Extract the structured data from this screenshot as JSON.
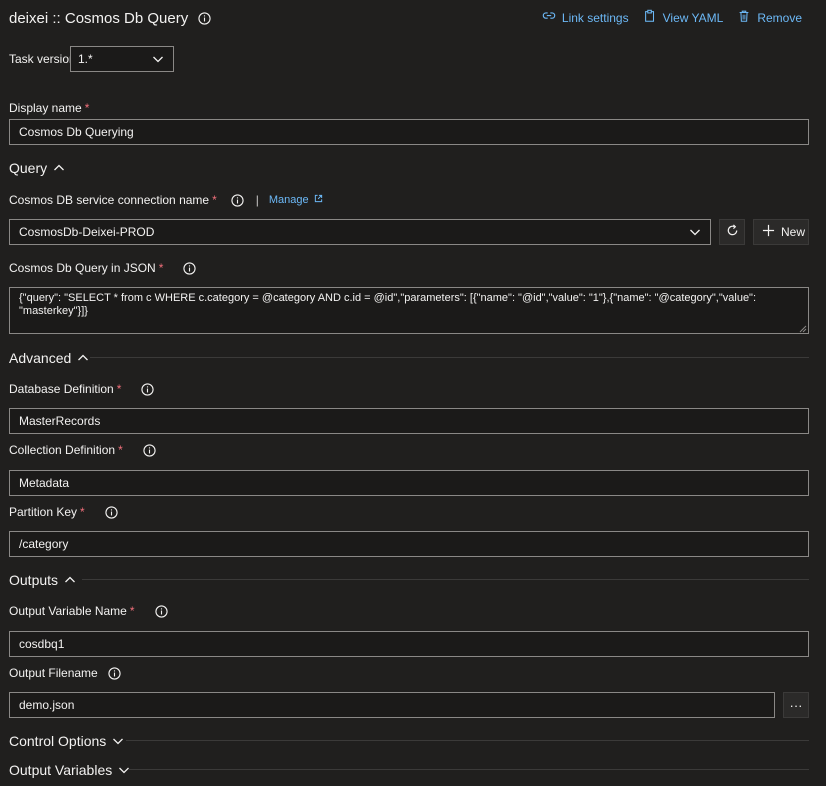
{
  "header": {
    "title": "deixei :: Cosmos Db Query",
    "link_settings": "Link settings",
    "view_yaml": "View YAML",
    "remove": "Remove"
  },
  "task_version": {
    "label": "Task version",
    "value": "1.*"
  },
  "display_name": {
    "label": "Display name",
    "value": "Cosmos Db Querying"
  },
  "query_section": {
    "title": "Query",
    "connection_label": "Cosmos DB service connection name",
    "manage": "Manage",
    "connection_value": "CosmosDb-Deixei-PROD",
    "new_label": "New",
    "query_label": "Cosmos Db Query in JSON",
    "query_value": "{\"query\": \"SELECT * from c WHERE c.category = @category AND c.id = @id\",\"parameters\": [{\"name\": \"@id\",\"value\": \"1\"},{\"name\": \"@category\",\"value\": \"masterkey\"}]}"
  },
  "advanced_section": {
    "title": "Advanced",
    "database_label": "Database Definition",
    "database_value": "MasterRecords",
    "collection_label": "Collection Definition",
    "collection_value": "Metadata",
    "partition_label": "Partition Key",
    "partition_value": "/category"
  },
  "outputs_section": {
    "title": "Outputs",
    "varname_label": "Output Variable Name",
    "varname_value": "cosdbq1",
    "filename_label": "Output Filename",
    "filename_value": "demo.json",
    "browse_label": "···"
  },
  "control_options": {
    "title": "Control Options"
  },
  "output_variables": {
    "title": "Output Variables"
  }
}
